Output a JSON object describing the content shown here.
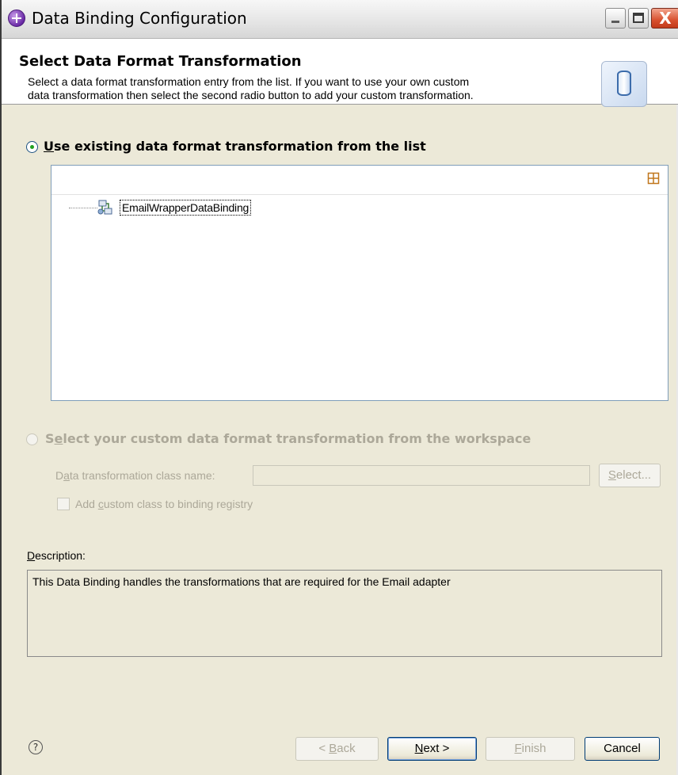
{
  "window": {
    "title": "Data Binding Configuration",
    "close_glyph": "X"
  },
  "header": {
    "title": "Select Data Format Transformation",
    "description_line1": "Select a data format transformation entry from the list.  If you want to use your own custom",
    "description_line2": "data transformation then select the second radio button to add your custom transformation.",
    "image_icon": "database-cylinder-icon"
  },
  "options": {
    "existing": {
      "mnemonic": "U",
      "label_rest": "se existing data format transformation from the list",
      "selected": true
    },
    "custom": {
      "label_start": "S",
      "mnemonic": "e",
      "label_rest": "lect your custom data format transformation from the workspace",
      "selected": false,
      "enabled": false
    }
  },
  "list": {
    "toolbar_icon": "expand-all-icon",
    "items": [
      {
        "label": "EmailWrapperDataBinding",
        "icon": "data-binding-icon",
        "selected": true
      }
    ]
  },
  "custom_form": {
    "class_name_label_start": "D",
    "class_name_label_mnemonic": "a",
    "class_name_label_rest": "ta transformation class name:",
    "class_name_value": "",
    "select_button_mnemonic": "S",
    "select_button_rest": "elect...",
    "checkbox_label_start": "Add ",
    "checkbox_label_mnemonic": "c",
    "checkbox_label_rest": "ustom class to binding registry",
    "checkbox_checked": false
  },
  "description": {
    "label_mnemonic": "D",
    "label_rest": "escription:",
    "text": "This Data Binding handles the transformations that are required for the Email adapter"
  },
  "footer": {
    "help_glyph": "?",
    "back_prefix": "< ",
    "back_mnemonic": "B",
    "back_rest": "ack",
    "next_mnemonic": "N",
    "next_rest": "ext >",
    "finish_mnemonic": "F",
    "finish_rest": "inish",
    "cancel_label": "Cancel"
  },
  "colors": {
    "dialog_bg": "#ece9d8",
    "selected_radio": "#21a121",
    "disabled_text": "#aca899"
  }
}
